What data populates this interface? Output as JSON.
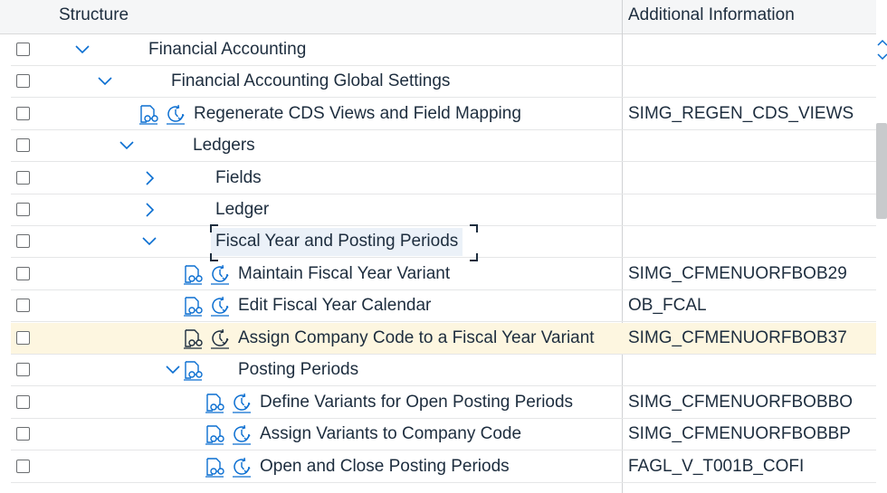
{
  "header": {
    "structure": "Structure",
    "additional_info": "Additional Information"
  },
  "rows": [
    {
      "label": "Financial Accounting",
      "info": "",
      "expanded": true
    },
    {
      "label": "Financial Accounting Global Settings",
      "info": "",
      "expanded": true
    },
    {
      "label": "Regenerate CDS Views and Field Mapping",
      "info": "SIMG_REGEN_CDS_VIEWS"
    },
    {
      "label": "Ledgers",
      "info": "",
      "expanded": true
    },
    {
      "label": "Fields",
      "info": "",
      "expanded": false
    },
    {
      "label": "Ledger",
      "info": "",
      "expanded": false
    },
    {
      "label": "Fiscal Year and Posting Periods",
      "info": "",
      "expanded": true,
      "focused": true
    },
    {
      "label": "Maintain Fiscal Year Variant",
      "info": "SIMG_CFMENUORFBOB29"
    },
    {
      "label": "Edit Fiscal Year Calendar",
      "info": "OB_FCAL"
    },
    {
      "label": "Assign Company Code to a Fiscal Year Variant",
      "info": "SIMG_CFMENUORFBOB37",
      "selected": true
    },
    {
      "label": "Posting Periods",
      "info": "",
      "expanded": true
    },
    {
      "label": "Define Variants for Open Posting Periods",
      "info": "SIMG_CFMENUORFBOBBO"
    },
    {
      "label": "Assign Variants to Company Code",
      "info": "SIMG_CFMENUORFBOBBP"
    },
    {
      "label": "Open and Close Posting Periods",
      "info": "FAGL_V_T001B_COFI"
    }
  ],
  "icons": {
    "chevron_expanded": "chevron-down-icon",
    "chevron_collapsed": "chevron-right-icon",
    "documentation": "documentation-glasses-icon",
    "execute": "execute-clock-icon"
  },
  "colors": {
    "icon_blue": "#0a6ed1",
    "selected_row": "#fdf6e0",
    "focus_bg": "#ebf1f8"
  }
}
